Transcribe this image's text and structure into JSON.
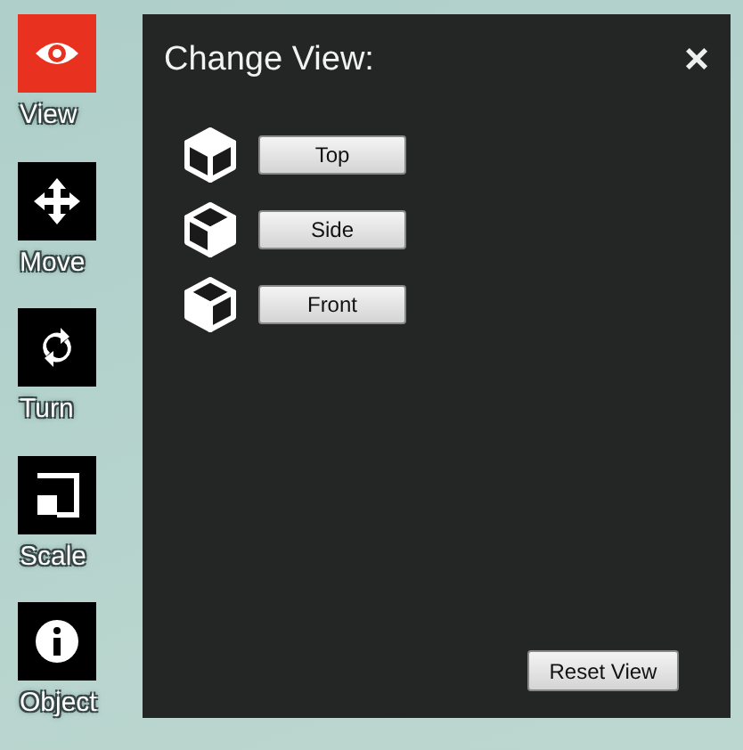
{
  "tools": [
    {
      "label": "View",
      "kind": "eye",
      "selected": true
    },
    {
      "label": "Move",
      "kind": "move",
      "selected": false
    },
    {
      "label": "Turn",
      "kind": "turn",
      "selected": false
    },
    {
      "label": "Scale",
      "kind": "scale",
      "selected": false
    },
    {
      "label": "Object",
      "kind": "info",
      "selected": false
    }
  ],
  "panel": {
    "title": "Change View:",
    "close": "×",
    "views": [
      {
        "label": "Top",
        "kind": "top"
      },
      {
        "label": "Side",
        "kind": "side"
      },
      {
        "label": "Front",
        "kind": "front"
      }
    ],
    "reset": "Reset View"
  }
}
